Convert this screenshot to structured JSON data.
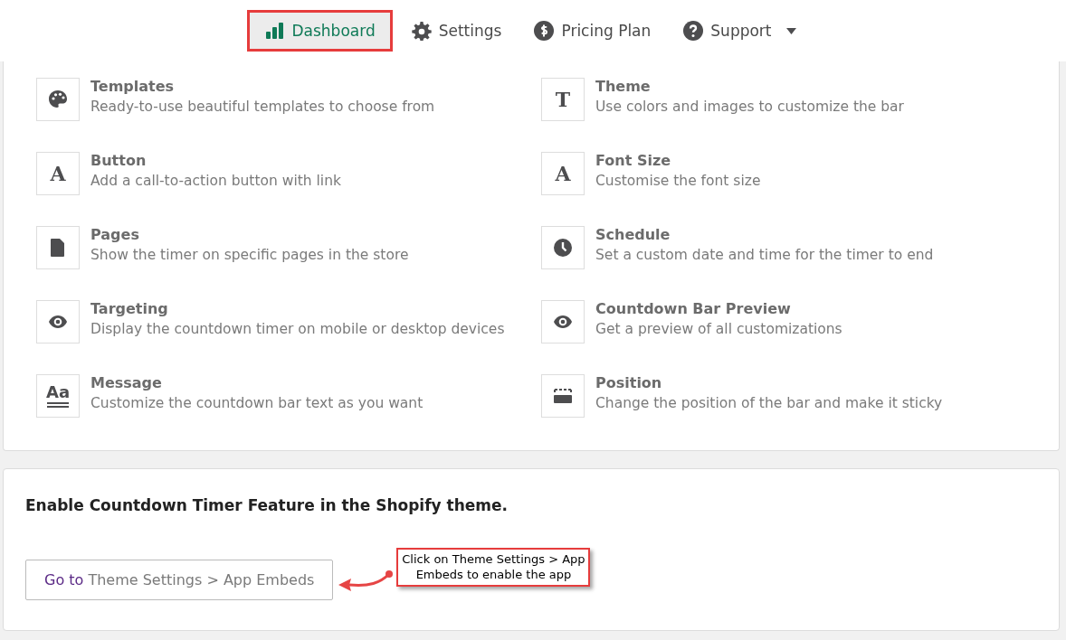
{
  "nav": [
    {
      "label": "Dashboard",
      "kind": "chart",
      "selected": true,
      "dropdown": false
    },
    {
      "label": "Settings",
      "kind": "gear",
      "selected": false,
      "dropdown": false
    },
    {
      "label": "Pricing Plan",
      "kind": "dollar",
      "selected": false,
      "dropdown": false
    },
    {
      "label": "Support",
      "kind": "question",
      "selected": false,
      "dropdown": true
    }
  ],
  "features": [
    {
      "title": "Templates",
      "description": "Ready-to-use beautiful templates to choose from",
      "kind": "palette"
    },
    {
      "title": "Theme",
      "description": "Use colors and images to customize the bar",
      "kind": "letter",
      "glyph": "T"
    },
    {
      "title": "Button",
      "description": "Add a call-to-action button with link",
      "kind": "letter",
      "glyph": "A"
    },
    {
      "title": "Font Size",
      "description": "Customise the font size",
      "kind": "letter",
      "glyph": "A"
    },
    {
      "title": "Pages",
      "description": "Show the timer on specific pages in the store",
      "kind": "page"
    },
    {
      "title": "Schedule",
      "description": "Set a custom date and time for the timer to end",
      "kind": "clock"
    },
    {
      "title": "Targeting",
      "description": "Display the countdown timer on mobile or desktop devices",
      "kind": "eye"
    },
    {
      "title": "Countdown Bar Preview",
      "description": "Get a preview of all customizations",
      "kind": "eye"
    },
    {
      "title": "Message",
      "description": "Customize the countdown bar text as you want",
      "kind": "typography",
      "glyph": "Aa"
    },
    {
      "title": "Position",
      "description": "Change the position of the bar and make it sticky",
      "kind": "position"
    }
  ],
  "enable_card": {
    "heading": "Enable Countdown Timer Feature in the Shopify theme.",
    "button": {
      "lead": "Go to",
      "rest": "Theme Settings > App Embeds"
    },
    "callout": "Click on Theme Settings > App Embeds to enable the app"
  }
}
